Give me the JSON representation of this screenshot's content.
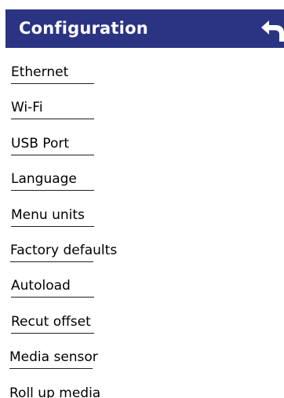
{
  "header": {
    "title": "Configuration",
    "back_icon": "undo-arrow-icon",
    "background_color": "#2b3483",
    "text_color": "#ffffff"
  },
  "menu": {
    "items": [
      {
        "label": "Ethernet"
      },
      {
        "label": "Wi-Fi"
      },
      {
        "label": "USB Port"
      },
      {
        "label": "Language"
      },
      {
        "label": "Menu units"
      },
      {
        "label": "Factory defaults"
      },
      {
        "label": "Autoload"
      },
      {
        "label": "Recut offset"
      },
      {
        "label": "Media sensor"
      },
      {
        "label": "Roll up media"
      }
    ]
  }
}
